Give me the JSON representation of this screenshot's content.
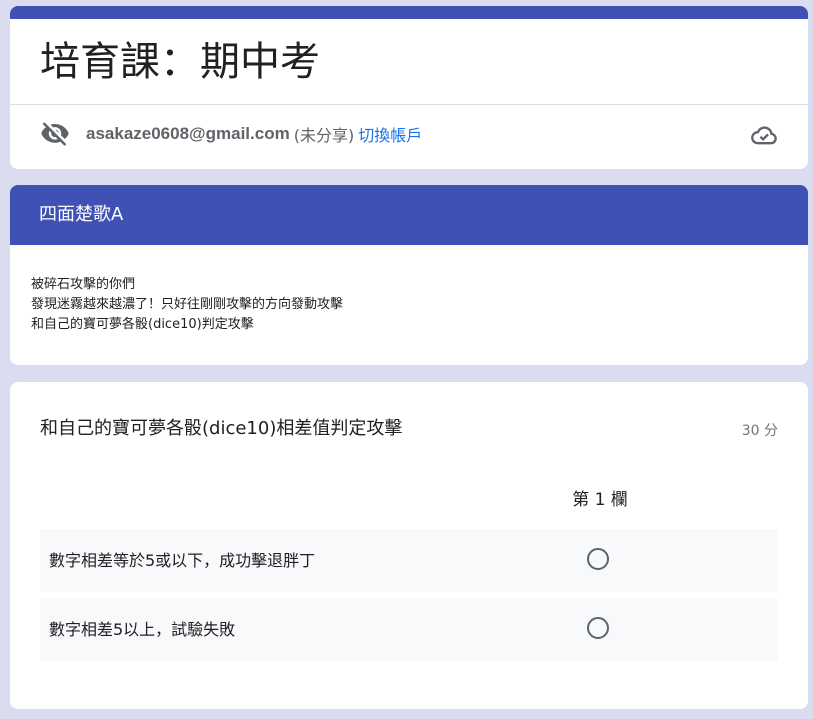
{
  "form": {
    "title": "培育課：期中考",
    "accent_color": "#3f51b5"
  },
  "account": {
    "email": "asakaze0608@gmail.com",
    "status": "(未分享)",
    "switch_label": "切換帳戶",
    "hidden_icon": "visibility-off-icon",
    "cloud_icon": "cloud-done-icon"
  },
  "section": {
    "title": "四面楚歌A",
    "description": [
      "被碎石攻擊的你們",
      "發現迷霧越來越濃了！只好往剛剛攻擊的方向發動攻擊",
      "和自己的寶可夢各骰(dice10)判定攻擊"
    ]
  },
  "question": {
    "title": "和自己的寶可夢各骰(dice10)相差值判定攻擊",
    "points": "30 分",
    "columns": [
      "第 1 欄"
    ],
    "rows": [
      {
        "label": "數字相差等於5或以下，成功擊退胖丁"
      },
      {
        "label": "數字相差5以上，試驗失敗"
      }
    ]
  }
}
